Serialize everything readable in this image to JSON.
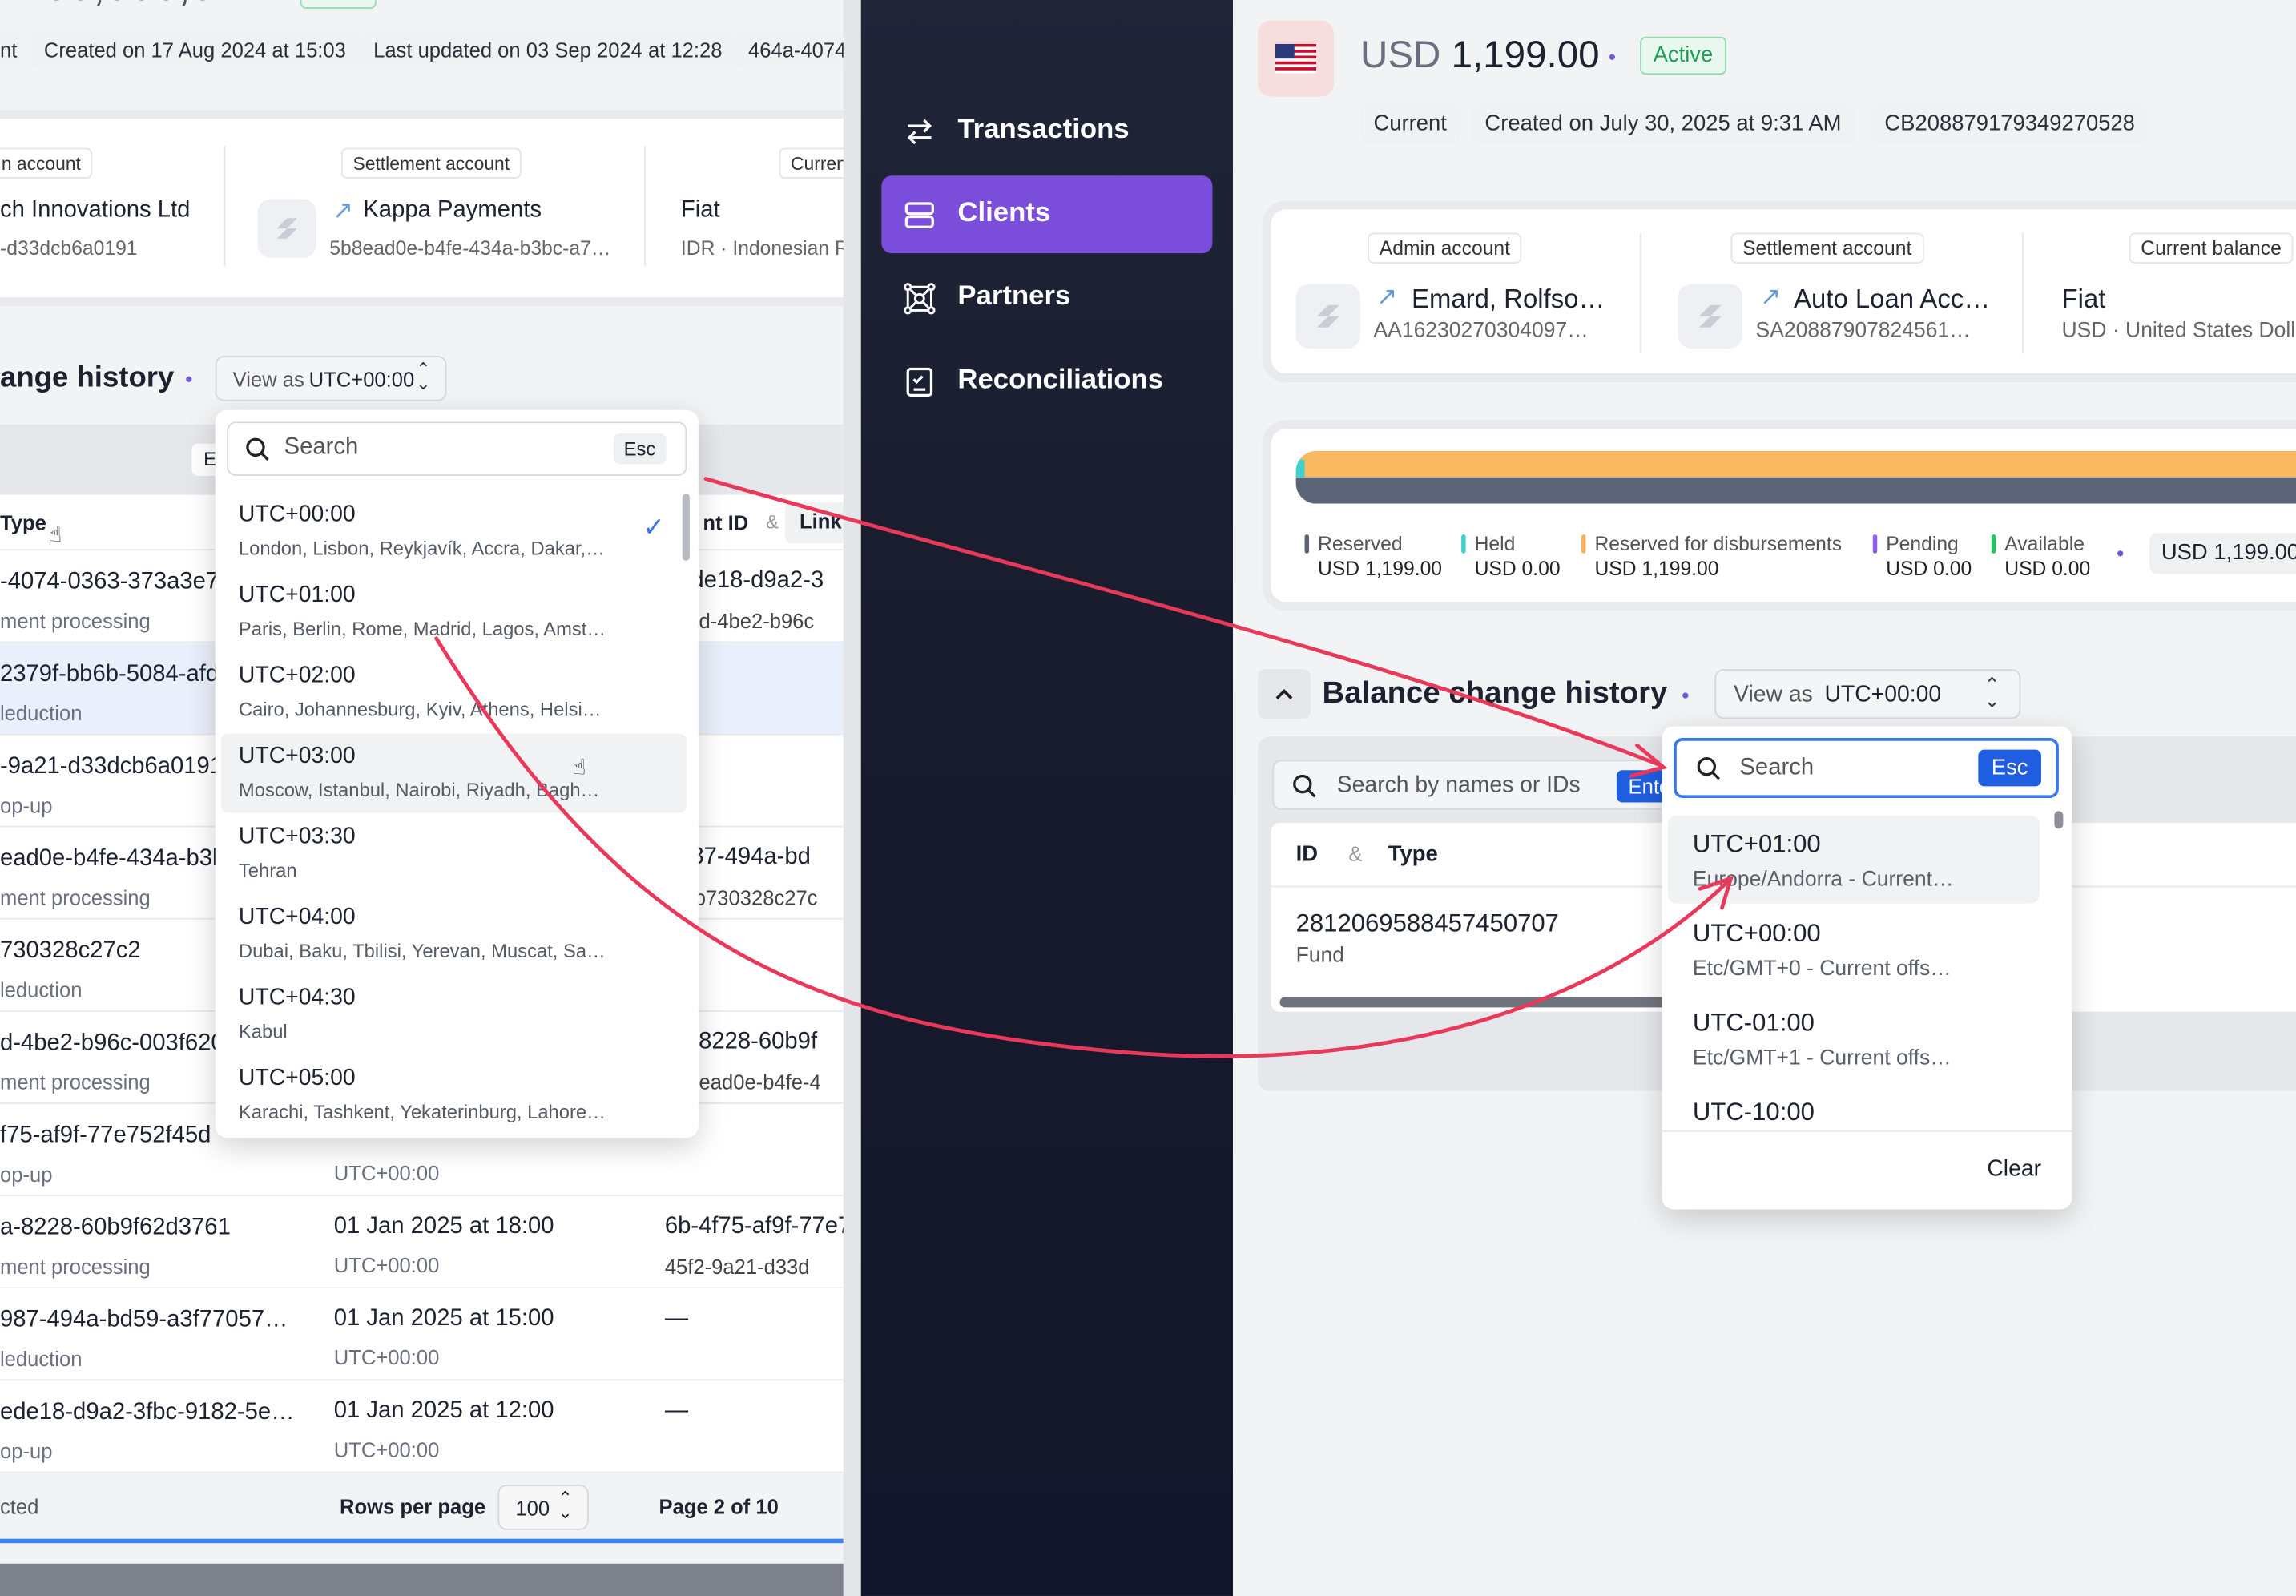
{
  "left": {
    "header": {
      "created": "Created on 17 Aug 2024 at 15:03",
      "updated": "Last updated on 03 Sep 2024 at 12:28",
      "id_frag": "464a-4074",
      "pill_left": "nt"
    },
    "accounts": {
      "admin_label": "n account",
      "admin_name": "ch Innovations Ltd",
      "admin_id": "-d33dcb6a0191",
      "settle_label": "Settlement account",
      "settle_name": "Kappa Payments",
      "settle_id": "5b8ead0e-b4fe-434a-b3bc-a7…",
      "curr_label": "Curren",
      "curr_type": "Fiat",
      "curr_desc": "IDR · Indonesian R"
    },
    "history": {
      "title": "ange history",
      "view_label": "View as",
      "view_value": "UTC+00:00"
    },
    "table": {
      "col_type": "Type",
      "col_id_frag": "nt ID",
      "col_amp": "&",
      "col_link": "Link",
      "col_e": "E",
      "rows": [
        {
          "a": "-4074-0363-373a3e7",
          "b": "ment processing",
          "c": "",
          "d": "",
          "e": "6ede18-d9a2-3",
          "f": "0aad-4be2-b96c"
        },
        {
          "a": "2379f-bb6b-5084-afd4",
          "b": "leduction",
          "c": "",
          "d": "",
          "e": "",
          "f": ""
        },
        {
          "a": "-9a21-d33dcb6a0191",
          "b": "op-up",
          "c": "",
          "d": "",
          "e": "",
          "f": ""
        },
        {
          "a": "ead0e-b4fe-434a-b3bc",
          "b": "ment processing",
          "c": "",
          "d": "",
          "e": "6987-494a-bd",
          "f": "50-b730328c27c"
        },
        {
          "a": "730328c27c2",
          "b": "leduction",
          "c": "",
          "d": "",
          "e": "",
          "f": ""
        },
        {
          "a": "d-4be2-b96c-003f620",
          "b": "ment processing",
          "c": "",
          "d": "",
          "e": "4a-8228-60b9f",
          "f": "5b8ead0e-b4fe-4"
        },
        {
          "a": "f75-af9f-77e752f45d",
          "b": "op-up",
          "c": "",
          "d": "UTC+00:00",
          "e": "—",
          "f": ""
        },
        {
          "a": "a-8228-60b9f62d3761",
          "b": "ment processing",
          "c": "01 Jan 2025 at 18:00",
          "d": "UTC+00:00",
          "e": "6b-4f75-af9f-77e7",
          "f": "45f2-9a21-d33d"
        },
        {
          "a": "987-494a-bd59-a3f77057…",
          "b": "leduction",
          "c": "01 Jan 2025 at 15:00",
          "d": "UTC+00:00",
          "e": "—",
          "f": ""
        },
        {
          "a": "ede18-d9a2-3fbc-9182-5e…",
          "b": "op-up",
          "c": "01 Jan 2025 at 12:00",
          "d": "UTC+00:00",
          "e": "—",
          "f": ""
        }
      ]
    },
    "footer": {
      "selected": "cted",
      "rows_label": "Rows per page",
      "rows_value": "100",
      "page": "Page 2 of 10"
    },
    "dropdown": {
      "search_placeholder": "Search",
      "esc": "Esc",
      "options": [
        {
          "tz": "UTC+00:00",
          "cities": "London, Lisbon, Reykjavík, Accra, Dakar,…",
          "selected": true
        },
        {
          "tz": "UTC+01:00",
          "cities": "Paris, Berlin, Rome, Madrid, Lagos, Amst…"
        },
        {
          "tz": "UTC+02:00",
          "cities": "Cairo, Johannesburg, Kyiv, Athens, Helsi…"
        },
        {
          "tz": "UTC+03:00",
          "cities": "Moscow, Istanbul, Nairobi, Riyadh, Bagh…",
          "hover": true
        },
        {
          "tz": "UTC+03:30",
          "cities": "Tehran"
        },
        {
          "tz": "UTC+04:00",
          "cities": "Dubai, Baku, Tbilisi, Yerevan, Muscat, Sa…"
        },
        {
          "tz": "UTC+04:30",
          "cities": "Kabul"
        },
        {
          "tz": "UTC+05:00",
          "cities": "Karachi, Tashkent, Yekaterinburg, Lahore…"
        }
      ]
    }
  },
  "nav": {
    "items": [
      {
        "label": "Transactions",
        "icon": "swap-arrows-icon"
      },
      {
        "label": "Clients",
        "icon": "stack-icon",
        "active": true
      },
      {
        "label": "Partners",
        "icon": "network-icon"
      },
      {
        "label": "Reconciliations",
        "icon": "checklist-icon"
      }
    ]
  },
  "right": {
    "header": {
      "currency": "USD",
      "amount": "1,199.00",
      "status": "Active",
      "tag1": "Current",
      "created": "Created on July 30, 2025 at 9:31 AM",
      "account_id": "CB208879179349270528"
    },
    "accounts": {
      "admin_label": "Admin account",
      "admin_name": "Emard, Rolfso…",
      "admin_id": "AA16230270304097…",
      "settle_label": "Settlement account",
      "settle_name": "Auto Loan Acc…",
      "settle_id": "SA20887907824561…",
      "curr_label": "Current balance",
      "curr_type": "Fiat",
      "curr_desc": "USD · United States Doll"
    },
    "balance": {
      "legend": [
        {
          "name": "Reserved",
          "value": "USD 1,199.00",
          "color": "#5b6477"
        },
        {
          "name": "Held",
          "value": "USD 0.00",
          "color": "#3fd0c9"
        },
        {
          "name": "Reserved for disbursements",
          "value": "USD 1,199.00",
          "color": "#f6b360"
        },
        {
          "name": "Pending",
          "value": "USD 0.00",
          "color": "#8b5cf6"
        },
        {
          "name": "Available",
          "value": "USD 0.00",
          "color": "#22c55e"
        }
      ],
      "total": "USD 1,199.00",
      "bar_colors": [
        "#f8b860",
        "#5b6477"
      ]
    },
    "history": {
      "title": "Balance change history",
      "view_label": "View as",
      "view_value": "UTC+00:00",
      "search_placeholder": "Search by names or IDs",
      "enter": "Ente",
      "col_id": "ID",
      "col_amp": "&",
      "col_type": "Type",
      "row_id": "2812069588457450707",
      "row_type": "Fund"
    },
    "dropdown": {
      "search_placeholder": "Search",
      "esc": "Esc",
      "options": [
        {
          "tz": "UTC+01:00",
          "desc": "Europe/Andorra - Current…",
          "hover": true
        },
        {
          "tz": "UTC+00:00",
          "desc": "Etc/GMT+0 - Current offs…"
        },
        {
          "tz": "UTC-01:00",
          "desc": "Etc/GMT+1 - Current offs…"
        },
        {
          "tz": "UTC-10:00",
          "desc": ""
        }
      ],
      "clear": "Clear"
    }
  },
  "colors": {
    "nav_bg": "#161a2b",
    "nav_active": "#7b4ddb",
    "active_green": "#1f9d57",
    "annotation": "#e8395b",
    "esc_blue": "#1f5ee0"
  }
}
